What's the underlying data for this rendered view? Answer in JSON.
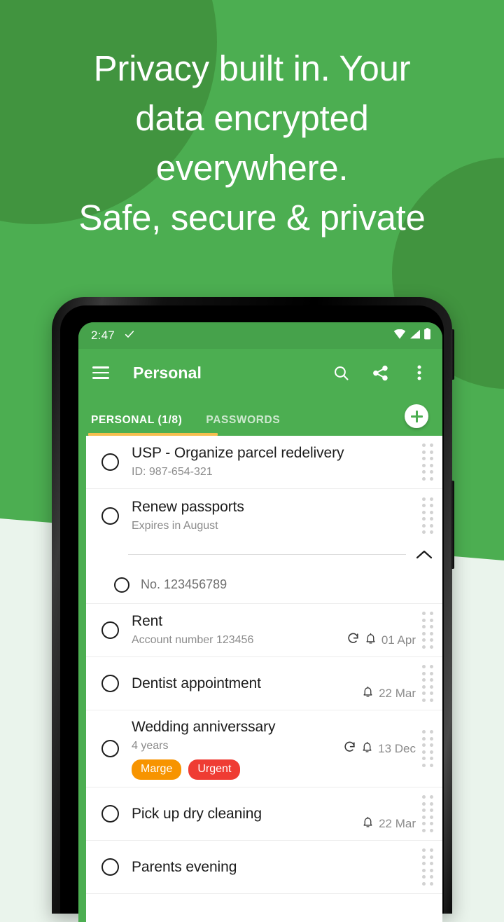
{
  "promo": {
    "headline": "Privacy built in. Your\ndata encrypted\neverywhere.\nSafe, secure & private",
    "bg_color": "#4CAE51",
    "blob_color": "#41943F",
    "lower_bg_color": "#EAF4EC"
  },
  "statusbar": {
    "time": "2:47",
    "check_icon": "✓",
    "wifi_icon": "wifi-icon",
    "signal_icon": "signal-icon",
    "battery_icon": "battery-icon"
  },
  "appbar": {
    "menu_icon": "hamburger-menu-icon",
    "title": "Personal",
    "search_icon": "search-icon",
    "share_icon": "share-icon",
    "overflow_icon": "more-vert-icon"
  },
  "tabs": {
    "active": {
      "label": "PERSONAL (1/8)"
    },
    "inactive": {
      "label": "PASSWORDS"
    },
    "indicator_color": "#F6BE4F",
    "fab_label": "+"
  },
  "list": {
    "rows": [
      {
        "title": "USP - Organize parcel redelivery",
        "subtitle": "ID: 987-654-321",
        "meta": "",
        "repeat": false,
        "reminder": false,
        "chips": []
      },
      {
        "title": "Renew passports",
        "subtitle": "Expires in August",
        "meta": "",
        "repeat": false,
        "reminder": false,
        "chips": [],
        "expanded": true,
        "children": [
          {
            "text": "No. 123456789"
          }
        ]
      },
      {
        "title": "Rent",
        "subtitle": "Account number 123456",
        "meta": "01 Apr",
        "repeat": true,
        "reminder": true,
        "chips": []
      },
      {
        "title": "Dentist appointment",
        "subtitle": "",
        "meta": "22 Mar",
        "repeat": false,
        "reminder": true,
        "chips": []
      },
      {
        "title": "Wedding anniverssary",
        "subtitle": "4 years",
        "meta": "13 Dec",
        "repeat": true,
        "reminder": true,
        "chips": [
          {
            "label": "Marge",
            "color": "#F79400"
          },
          {
            "label": "Urgent",
            "color": "#EF3C33"
          }
        ]
      },
      {
        "title": "Pick up dry cleaning",
        "subtitle": "",
        "meta": "22 Mar",
        "repeat": false,
        "reminder": true,
        "chips": []
      },
      {
        "title": "Parents evening",
        "subtitle": "",
        "meta": "",
        "repeat": false,
        "reminder": false,
        "chips": []
      }
    ]
  }
}
